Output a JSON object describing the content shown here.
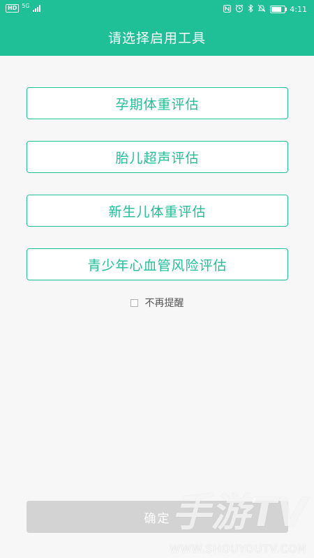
{
  "status_bar": {
    "hd_label": "HD",
    "network_label": "5G",
    "time": "4:11",
    "battery_level": 0.8,
    "icons": [
      "nfc-icon",
      "alarm-icon",
      "bluetooth-icon",
      "mute-icon",
      "battery-icon"
    ]
  },
  "header": {
    "title": "请选择启用工具"
  },
  "options": [
    {
      "label": "孕期体重评估"
    },
    {
      "label": "胎儿超声评估"
    },
    {
      "label": "新生儿体重评估"
    },
    {
      "label": "青少年心血管风险评估"
    }
  ],
  "remind": {
    "label": "不再提醒",
    "checked": false
  },
  "confirm": {
    "label": "确定"
  },
  "watermark": {
    "main": "手游TV",
    "sub": "WWW.SHOUYOUTV.COM"
  },
  "colors": {
    "accent": "#1fbf98",
    "confirm_disabled": "#d3d3d3",
    "background": "#f7f7f8"
  }
}
